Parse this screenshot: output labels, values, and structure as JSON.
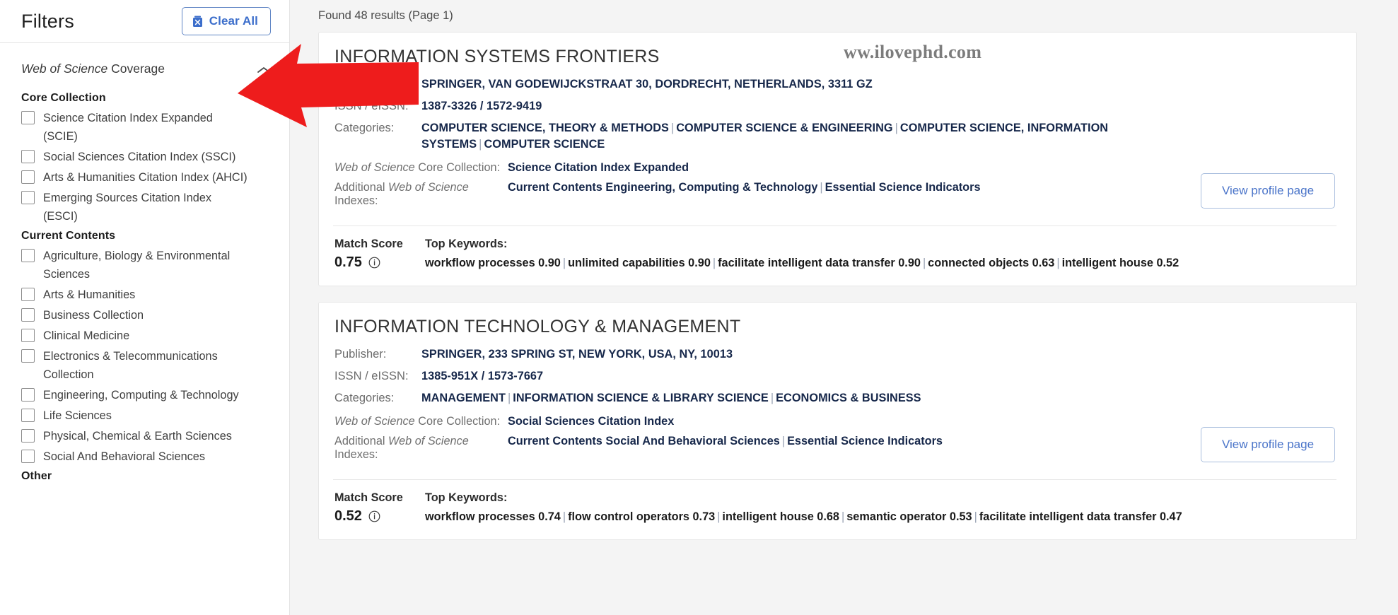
{
  "sidebar": {
    "title": "Filters",
    "clear_all_label": "Clear All",
    "clear_all_icon": "trash-icon",
    "coverage_label_italic": "Web of Science",
    "coverage_label_rest": " Coverage",
    "collapse_icon": "chevron-up-icon",
    "groups": [
      {
        "heading": "Core Collection",
        "items": [
          {
            "label": "Science Citation Index Expanded (SCIE)",
            "checked": false
          },
          {
            "label": "Social Sciences Citation Index (SSCI)",
            "checked": false
          },
          {
            "label": "Arts & Humanities Citation Index (AHCI)",
            "checked": false
          },
          {
            "label": "Emerging Sources Citation Index (ESCI)",
            "checked": false
          }
        ]
      },
      {
        "heading": "Current Contents",
        "items": [
          {
            "label": "Agriculture, Biology & Environmental Sciences",
            "checked": false
          },
          {
            "label": "Arts & Humanities",
            "checked": false
          },
          {
            "label": "Business Collection",
            "checked": false
          },
          {
            "label": "Clinical Medicine",
            "checked": false
          },
          {
            "label": "Electronics & Telecommunications Collection",
            "checked": false
          },
          {
            "label": "Engineering, Computing & Technology",
            "checked": false
          },
          {
            "label": "Life Sciences",
            "checked": false
          },
          {
            "label": "Physical, Chemical & Earth Sciences",
            "checked": false
          },
          {
            "label": "Social And Behavioral Sciences",
            "checked": false
          }
        ]
      },
      {
        "heading": "Other",
        "items": []
      }
    ]
  },
  "main": {
    "results_count": "Found 48 results (Page 1)",
    "watermark": "ww.ilovephd.com",
    "labels": {
      "publisher": "Publisher:",
      "issn": "ISSN / eISSN:",
      "categories": "Categories:",
      "core_collection_italic": "Web of Science",
      "core_collection_rest": " Core Collection:",
      "additional_prefix": "Additional ",
      "additional_italic": "Web of Science",
      "additional_rest": " Indexes:",
      "match_score": "Match Score",
      "top_keywords": "Top Keywords:",
      "view_profile": "View profile page",
      "info_icon": "info-icon"
    },
    "results": [
      {
        "title": "INFORMATION SYSTEMS FRONTIERS",
        "publisher": "SPRINGER, VAN GODEWIJCKSTRAAT 30, DORDRECHT, NETHERLANDS, 3311 GZ",
        "issn": "1387-3326 / 1572-9419",
        "categories": "COMPUTER SCIENCE, THEORY & METHODS | COMPUTER SCIENCE & ENGINEERING | COMPUTER SCIENCE, INFORMATION SYSTEMS | COMPUTER SCIENCE",
        "core_collection": "Science Citation Index Expanded",
        "additional_indexes": "Current Contents Engineering, Computing & Technology | Essential Science Indicators",
        "match_score": "0.75",
        "keywords": "workflow processes 0.90 | unlimited capabilities 0.90 | facilitate intelligent data transfer 0.90 | connected objects 0.63 | intelligent house 0.52"
      },
      {
        "title": "INFORMATION TECHNOLOGY & MANAGEMENT",
        "publisher": "SPRINGER, 233 SPRING ST, NEW YORK, USA, NY, 10013",
        "issn": "1385-951X / 1573-7667",
        "categories": "MANAGEMENT | INFORMATION SCIENCE & LIBRARY SCIENCE | ECONOMICS & BUSINESS",
        "core_collection": "Social Sciences Citation Index",
        "additional_indexes": "Current Contents Social And Behavioral Sciences | Essential Science Indicators",
        "match_score": "0.52",
        "keywords": "workflow processes 0.74 | flow control operators 0.73 | intelligent house 0.68 | semantic operator 0.53 | facilitate intelligent data transfer 0.47"
      }
    ]
  },
  "annotation": {
    "arrow_icon": "red-left-arrow-annotation",
    "arrow_color": "#ee1c1c"
  },
  "colors": {
    "accent_blue": "#3c6ecb",
    "value_navy": "#16274a",
    "page_bg": "#f4f4f4"
  }
}
